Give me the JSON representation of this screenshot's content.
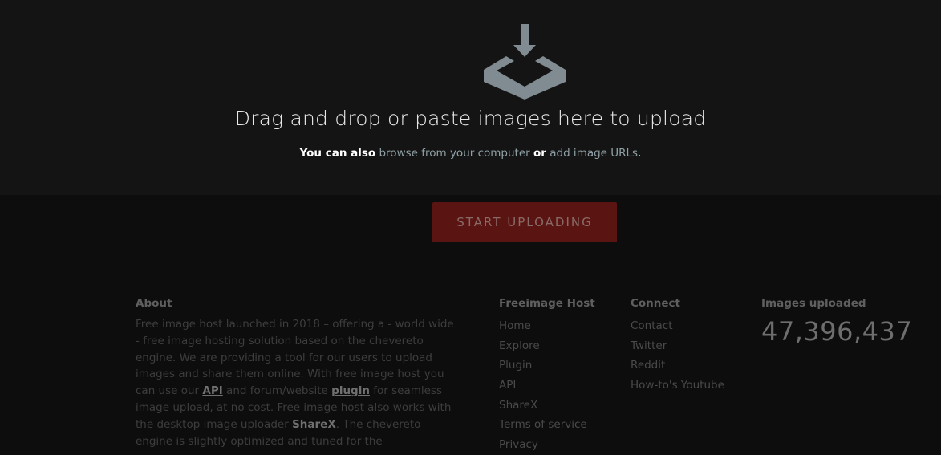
{
  "upload": {
    "icon": "upload-tray-icon",
    "title": "Drag and drop or paste images here to upload",
    "sub_prefix": "You can also",
    "sub_browse": "browse from your computer",
    "sub_or": "or",
    "sub_urls": "add image URLs",
    "sub_suffix": ".",
    "button_label": "START UPLOADING"
  },
  "footer": {
    "about": {
      "heading": "About",
      "text_1": "Free image host launched in 2018 – offering a - world wide - free image hosting solution based on the chevereto engine. We are providing a tool for our users to upload images and share them online. With free image host you can use our ",
      "api_link": "API",
      "text_2": " and forum/website ",
      "plugin_link": "plugin",
      "text_3": " for seamless image upload, at no cost. Free image host also works with the desktop image uploader ",
      "sharex_link": "ShareX",
      "text_4": ". The chevereto engine is slightly optimized and tuned for the"
    },
    "freeimage_host": {
      "heading": "Freeimage Host",
      "links": [
        "Home",
        "Explore",
        "Plugin",
        "API",
        "ShareX",
        "Terms of service",
        "Privacy"
      ]
    },
    "connect": {
      "heading": "Connect",
      "links": [
        "Contact",
        "Twitter",
        "Reddit",
        "How-to's Youtube"
      ]
    },
    "stats": {
      "heading": "Images uploaded",
      "value": "47,396,437"
    }
  },
  "colors": {
    "background": "#0d0d0d",
    "upload_zone": "#141414",
    "button_bg": "#5a1512",
    "link": "#8fa1a6"
  }
}
